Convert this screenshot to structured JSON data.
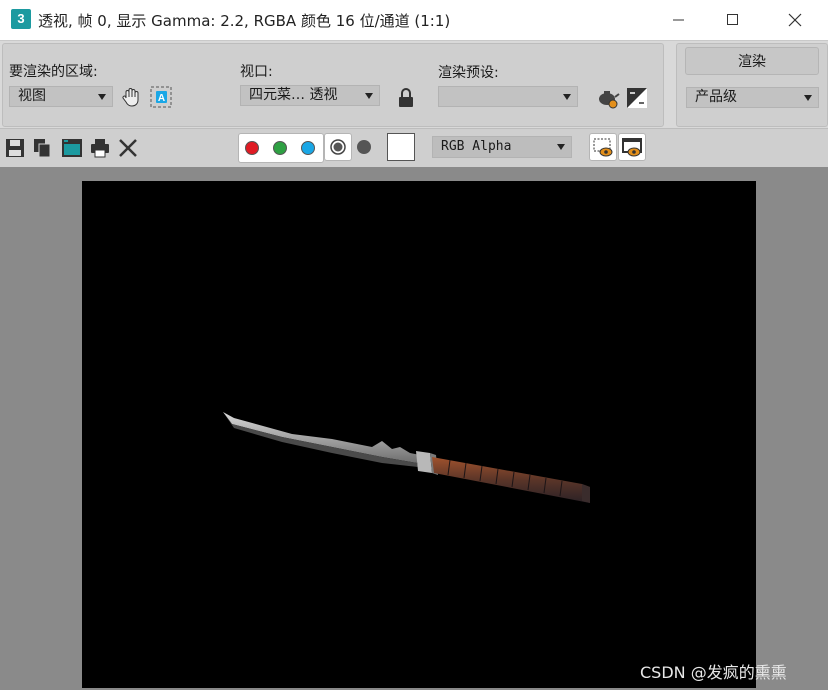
{
  "window": {
    "icon_label": "3",
    "title": "透视, 帧 0, 显示 Gamma: 2.2, RGBA 颜色 16 位/通道 (1:1)"
  },
  "render_area": {
    "label": "要渲染的区域:",
    "value": "视图"
  },
  "viewport": {
    "label": "视口:",
    "value": "四元菜… 透视"
  },
  "render_preset": {
    "label": "渲染预设:",
    "value": ""
  },
  "render": {
    "button_label": "渲染",
    "quality_value": "产品级"
  },
  "channel_display": {
    "value": "RGB Alpha"
  },
  "channels": {
    "red": "#e01b24",
    "green": "#2ea043",
    "blue": "#1aa7e6"
  },
  "watermark": "CSDN @发疯的熏熏"
}
